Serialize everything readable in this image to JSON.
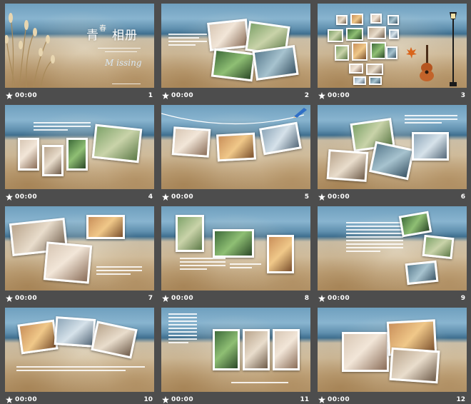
{
  "cover": {
    "title": "青春相册",
    "title_sup": "春",
    "title_main": "青　相册",
    "subtitle_en": "M     issing"
  },
  "slides": [
    {
      "number": "1",
      "duration": "00:00"
    },
    {
      "number": "2",
      "duration": "00:00"
    },
    {
      "number": "3",
      "duration": "00:00"
    },
    {
      "number": "4",
      "duration": "00:00"
    },
    {
      "number": "5",
      "duration": "00:00"
    },
    {
      "number": "6",
      "duration": "00:00"
    },
    {
      "number": "7",
      "duration": "00:00"
    },
    {
      "number": "8",
      "duration": "00:00"
    },
    {
      "number": "9",
      "duration": "00:00"
    },
    {
      "number": "10",
      "duration": "00:00"
    },
    {
      "number": "11",
      "duration": "00:00"
    },
    {
      "number": "12",
      "duration": "00:00"
    }
  ],
  "icons": {
    "transition": "star-transition-icon",
    "grass": "grass-icon",
    "guitar": "guitar-icon",
    "lamp": "street-lamp-icon",
    "pencil": "pencil-icon",
    "leaf": "maple-leaf-icon"
  },
  "colors": {
    "background": "#4d4d4d",
    "footer_text": "#ffffff",
    "sea": "#3f6f8f",
    "sand": "#d9c9ac"
  }
}
